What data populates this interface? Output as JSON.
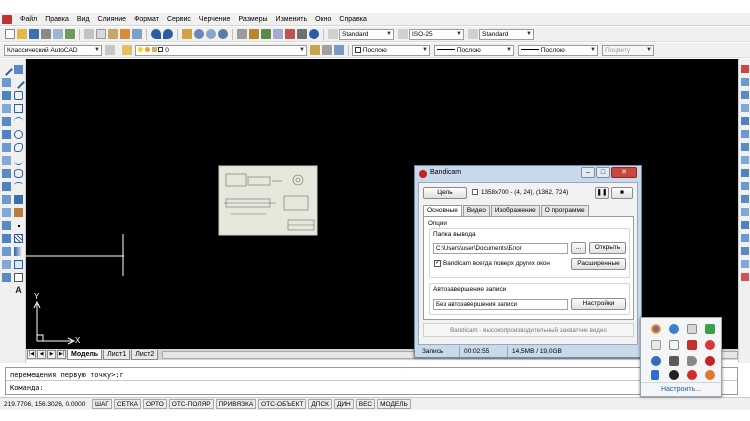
{
  "menu": [
    "Файл",
    "Правка",
    "Вид",
    "Слияние",
    "Формат",
    "Сервис",
    "Черчение",
    "Размеры",
    "Изменить",
    "Окно",
    "Справка"
  ],
  "toolbar": {
    "text_style": "Standard",
    "dim_style": "ISO-25",
    "table_style": "Standard",
    "workspace": "Классический AutoCAD",
    "layer": "0",
    "color": "Послою",
    "linetype": "Послою",
    "lineweight": "Послою",
    "plot_style": "Поцвету"
  },
  "layout_tabs": [
    "Модель",
    "Лист1",
    "Лист2"
  ],
  "ucs": {
    "x": "X",
    "y": "Y"
  },
  "command_line": {
    "history": "перемещения первую точку>:г",
    "prompt": "Команда:"
  },
  "status_bar": {
    "coords": "219.7706, 156.3026, 0.0000",
    "buttons": [
      "ШАГ",
      "СЕТКА",
      "ОРТО",
      "ОТС-ПОЛЯР",
      "ПРИВЯЗКА",
      "ОТС-ОБЪЕКТ",
      "ДПСК",
      "ДИН",
      "ВЕС",
      "МОДЕЛЬ"
    ]
  },
  "bandicam": {
    "title": "Bandicam",
    "target_button": "Цель",
    "region_info": "1358x700 - (4, 24), (1362, 724)",
    "tabs": [
      "Основные",
      "Видео",
      "Изображение",
      "О программе"
    ],
    "options_label": "Опции",
    "output_folder_label": "Папка вывода",
    "output_folder_value": "C:\\Users\\user\\Documents\\Блог",
    "browse_button": "...",
    "open_button": "Открыть",
    "always_on_top_label": "Bandicam всегда поверх других окон",
    "always_on_top_checked": true,
    "advanced_button": "Расширенные",
    "autocomplete_label": "Автозавершение записи",
    "autocomplete_value": "Без автозавершения записи",
    "settings_button": "Настройки",
    "footer": "Bandicam - высокопроизводительный захватчик видео",
    "status": {
      "label": "Запись",
      "time": "00:02:55",
      "size": "14,5MB / 19,0GB"
    }
  },
  "tray": {
    "customize_link": "Настроить...",
    "icons": [
      "chrome-icon",
      "globe-icon",
      "clipboard-icon",
      "network-icon",
      "mail-icon",
      "note-icon",
      "app-icon",
      "opera-icon",
      "info-icon",
      "monitor-icon",
      "volume-icon",
      "record-icon",
      "bluetooth-icon",
      "shield-icon",
      "antivirus-icon",
      "bandicam-tray-icon"
    ]
  },
  "colors": {
    "canvas": "#000000",
    "chrome": "#f0f0f0",
    "bandicam_frame": "#c9d9ec",
    "bandicam_logo": "#c62020",
    "link": "#1a5fb4"
  }
}
